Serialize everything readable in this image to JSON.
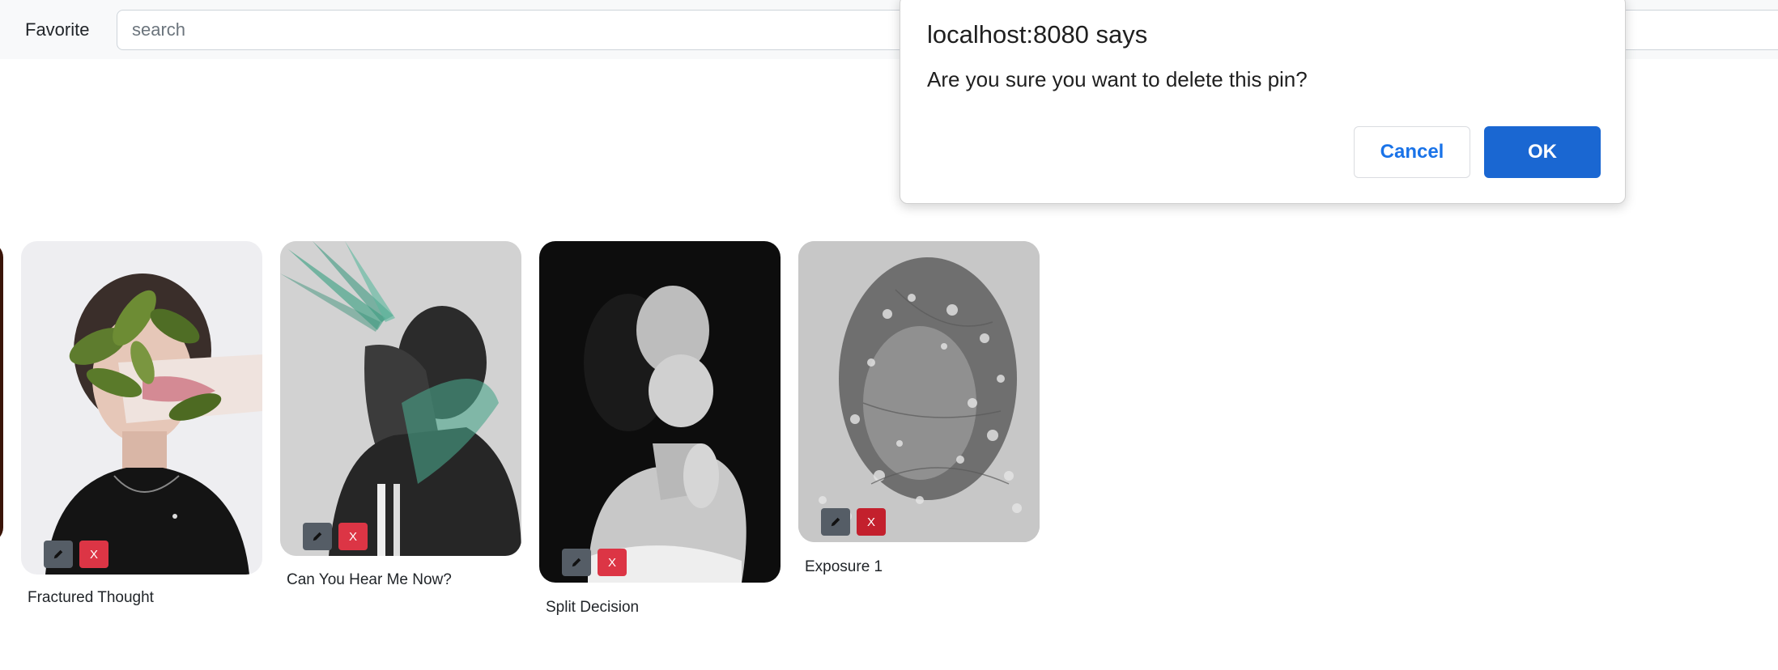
{
  "navbar": {
    "favorite_label": "Favorite",
    "search_placeholder": "search",
    "search_value": ""
  },
  "pins": [
    {
      "title": "Fractured Thought",
      "delete_label": "X",
      "edit_icon": "pencil-icon"
    },
    {
      "title": "Can You Hear Me Now?",
      "delete_label": "X",
      "edit_icon": "pencil-icon"
    },
    {
      "title": "Split Decision",
      "delete_label": "X",
      "edit_icon": "pencil-icon"
    },
    {
      "title": "Exposure 1",
      "delete_label": "X",
      "edit_icon": "pencil-icon"
    }
  ],
  "dialog": {
    "title": "localhost:8080 says",
    "message": "Are you sure you want to delete this pin?",
    "cancel_label": "Cancel",
    "ok_label": "OK"
  },
  "colors": {
    "accent": "#1a67d2",
    "delete": "#dc3545",
    "edit": "#555d66"
  }
}
